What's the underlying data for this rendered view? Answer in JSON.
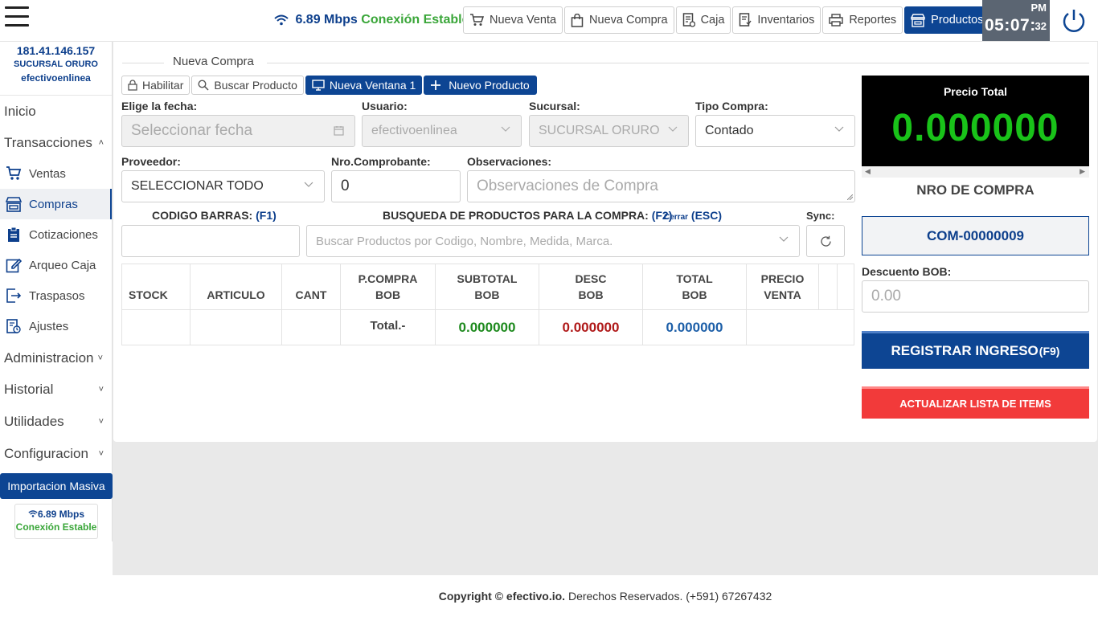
{
  "header": {
    "net_speed": "6.89 Mbps",
    "net_status": "Conexión Estable",
    "nav": [
      {
        "label": "Nueva Venta",
        "icon": "cart-icon"
      },
      {
        "label": "Nueva Compra",
        "icon": "bag-icon"
      },
      {
        "label": "Caja",
        "icon": "cash-register-icon"
      },
      {
        "label": "Inventarios",
        "icon": "inventory-icon"
      },
      {
        "label": "Reportes",
        "icon": "printer-icon"
      },
      {
        "label": "Productos",
        "icon": "store-icon"
      }
    ],
    "clock": {
      "ampm": "PM",
      "time": "05:07:",
      "seconds": "32"
    }
  },
  "sidebar": {
    "ip": "181.41.146.157",
    "branch": "SUCURSAL ORURO",
    "user": "efectivoenlinea",
    "items": [
      {
        "label": "Inicio"
      },
      {
        "label": "Transacciones",
        "chevron": "˄"
      },
      {
        "label": "Ventas",
        "icon": "cart-icon"
      },
      {
        "label": "Compras",
        "icon": "store-icon"
      },
      {
        "label": "Cotizaciones",
        "icon": "clipboard-icon"
      },
      {
        "label": "Arqueo Caja",
        "icon": "edit-icon"
      },
      {
        "label": "Traspasos",
        "icon": "transfer-icon"
      },
      {
        "label": "Ajustes",
        "icon": "adjust-icon"
      },
      {
        "label": "Administracion",
        "chevron": "˅"
      },
      {
        "label": "Historial",
        "chevron": "˅"
      },
      {
        "label": "Utilidades",
        "chevron": "˅"
      },
      {
        "label": "Configuracion",
        "chevron": "˅"
      }
    ],
    "import_label": "Importacion Masiva",
    "net_speed": "6.89 Mbps",
    "net_status": "Conexión Estable"
  },
  "form": {
    "title": "Nueva Compra",
    "toolbar": [
      "Habilitar",
      "Buscar Producto",
      "Nueva Ventana 1",
      "Nuevo Producto"
    ],
    "fecha_label": "Elige la fecha:",
    "fecha_placeholder": "Seleccionar fecha",
    "usuario_label": "Usuario:",
    "usuario_value": "efectivoenlinea",
    "sucursal_label": "Sucursal:",
    "sucursal_value": "SUCURSAL ORURO",
    "tipo_label": "Tipo Compra:",
    "tipo_value": "Contado",
    "proveedor_label": "Proveedor:",
    "proveedor_value": "SELECCIONAR TODO",
    "comprobante_label": "Nro.Comprobante:",
    "comprobante_value": "0",
    "obs_label": "Observaciones:",
    "obs_placeholder": "Observaciones de Compra",
    "barcode_label": "CODIGO BARRAS:",
    "barcode_key": "(F1)",
    "search_label": "BUSQUEDA DE PRODUCTOS PARA LA COMPRA:",
    "search_key": "(F2)",
    "close_label": "Cerrar",
    "close_key": "(ESC)",
    "search_placeholder": "Buscar Productos por Codigo, Nombre, Medida, Marca.",
    "sync_label": "Sync:"
  },
  "table": {
    "headers": [
      "STOCK",
      "ARTICULO",
      "CANT",
      "P.COMPRA\nBOB",
      "SUBTOTAL\nBOB",
      "DESC\nBOB",
      "TOTAL\nBOB",
      "PRECIO\nVENTA"
    ],
    "total_label": "Total.-",
    "subtotal": "0.000000",
    "desc": "0.000000",
    "total": "0.000000",
    "colors": {
      "subtotal": "#1e8a1e",
      "desc": "#b01a1a",
      "total": "#1d5fa8"
    }
  },
  "summary": {
    "price_title": "Precio Total",
    "price_value": "0.000000",
    "nro_title": "NRO DE COMPRA",
    "nro_value": "COM-00000009",
    "discount_label": "Descuento BOB:",
    "discount_placeholder": "0.00",
    "register_label": "REGISTRAR INGRESO",
    "register_key": "(F9)",
    "update_label": "ACTUALIZAR LISTA DE ITEMS"
  },
  "footer": {
    "prefix": "Copyright ©",
    "brand": "efectivo.io.",
    "suffix": "Derechos Reservados. (+591) 67267432"
  },
  "colors": {
    "primary": "#0d4593",
    "success": "#3aa639",
    "danger": "#f23a3a",
    "price": "#19c219"
  }
}
